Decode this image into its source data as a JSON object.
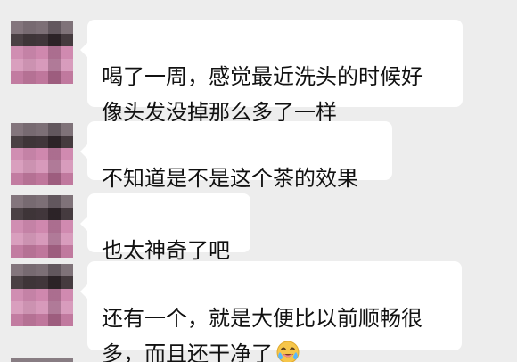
{
  "messages": [
    {
      "text": "喝了一周，感觉最近洗头的时候好\n像头发没掉那么多了一样",
      "emoji": ""
    },
    {
      "text": "不知道是不是这个茶的效果",
      "emoji": ""
    },
    {
      "text": "也太神奇了吧",
      "emoji": ""
    },
    {
      "text": "还有一个，就是大便比以前顺畅很\n多，而且还干净了",
      "emoji": "laughing-tears-emoji"
    }
  ],
  "colors": {
    "background": "#ededed",
    "bubble": "#ffffff",
    "text": "#111111"
  }
}
